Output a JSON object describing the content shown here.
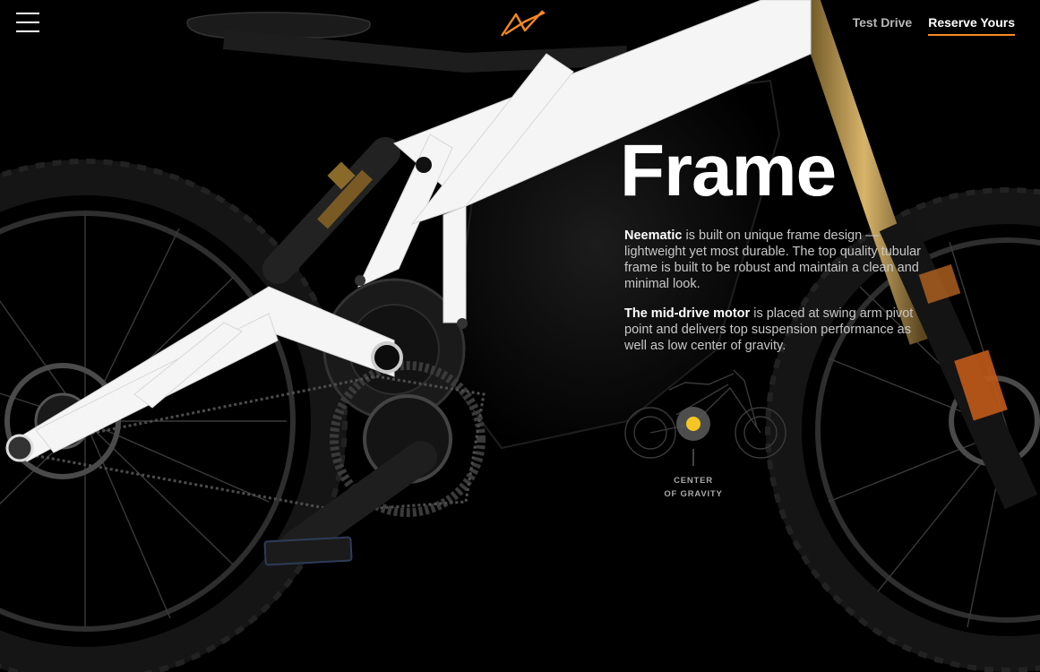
{
  "header": {
    "logo_icon": "neematic-logo-icon",
    "menu_icon": "hamburger-menu-icon",
    "nav": [
      {
        "label": "Test Drive"
      },
      {
        "label": "Reserve Yours",
        "active": true
      }
    ]
  },
  "hero": {
    "title": "Frame",
    "paragraph1": {
      "bold": "Neematic",
      "text": " is built on unique frame design — lightweight yet most durable. The top quality tubular frame is built to be robust and maintain a clean and minimal look."
    },
    "paragraph2": {
      "bold": "The mid-drive motor",
      "text": " is placed at swing arm pivot point and delivers top suspension performance as well as low center of gravity."
    },
    "diagram": {
      "label_line1": "CENTER",
      "label_line2": "OF GRAVITY"
    }
  },
  "colors": {
    "background": "#000000",
    "accent": "#f58a1f",
    "frame_white": "#ffffff",
    "fork_gold": "#c9a35a",
    "cog_dot": "#f5c623"
  }
}
